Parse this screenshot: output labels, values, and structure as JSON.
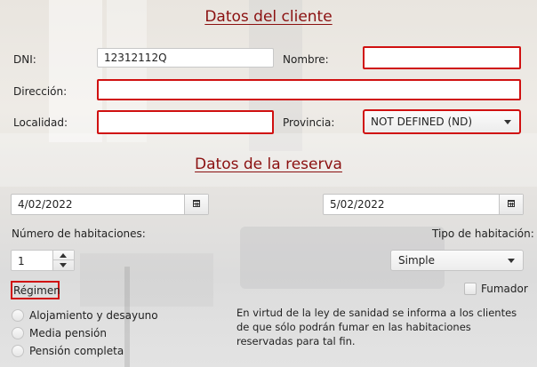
{
  "client": {
    "heading": "Datos del cliente",
    "dni_label": "DNI:",
    "dni_value": "12312112Q",
    "nombre_label": "Nombre:",
    "nombre_value": "",
    "direccion_label": "Dirección:",
    "direccion_value": "",
    "localidad_label": "Localidad:",
    "localidad_value": "",
    "provincia_label": "Provincia:",
    "provincia_selected": "NOT DEFINED (ND)"
  },
  "booking": {
    "heading": "Datos de la reserva",
    "fecha_entrada": "4/02/2022",
    "fecha_salida": "5/02/2022",
    "habitaciones_label": "Número de habitaciones:",
    "habitaciones_value": "1",
    "tipo_label": "Tipo de habitación:",
    "tipo_selected": "Simple",
    "regimen_label": "Régimen",
    "regimen_options": [
      "Alojamiento y desayuno",
      "Media pensión",
      "Pensión completa"
    ],
    "fumador_label": "Fumador",
    "notice": "En virtud de la ley de sanidad se informa a los clientes de que sólo podrán fumar en las habitaciones reservadas para tal fin."
  },
  "icons": {
    "calendar": "calendar-icon",
    "dropdown": "chevron-down-icon",
    "spin_up": "spin-up-icon",
    "spin_down": "spin-down-icon"
  },
  "colors": {
    "heading": "#8b1010",
    "error_border": "#d01010",
    "background": "#e6e3df"
  }
}
